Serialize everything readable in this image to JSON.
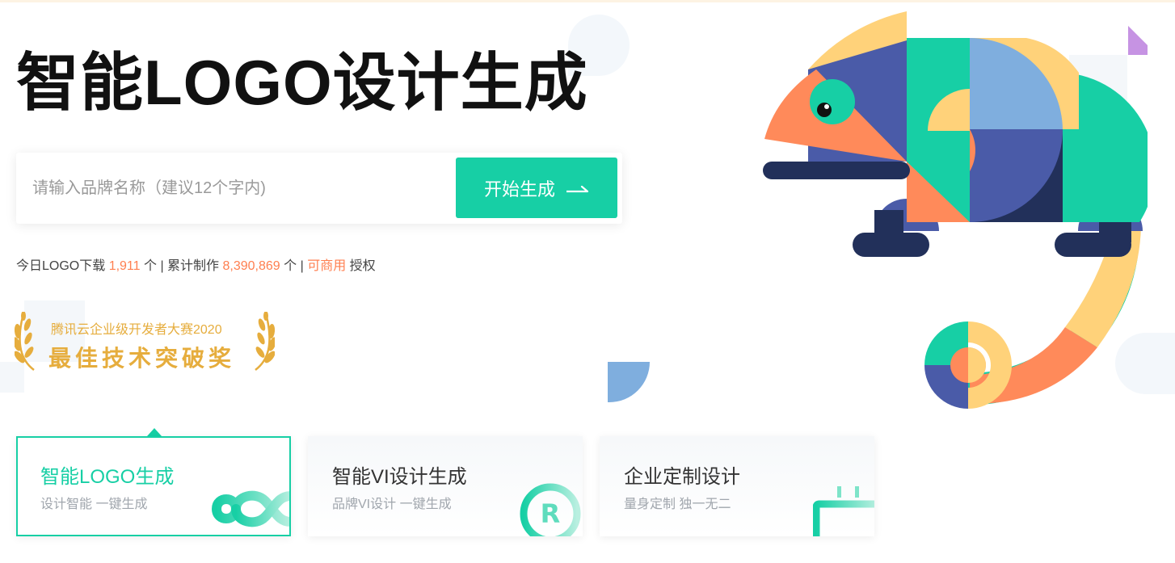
{
  "hero": {
    "title": "智能LOGO设计生成"
  },
  "search": {
    "placeholder": "请输入品牌名称（建议12个字内)",
    "button_label": "开始生成"
  },
  "stats": {
    "prefix": "今日LOGO下载 ",
    "downloads": "1,911",
    "mid1": " 个 | 累计制作 ",
    "total": "8,390,869",
    "mid2": " 个 | ",
    "commercial": "可商用",
    "suffix": " 授权"
  },
  "award": {
    "subtitle": "腾讯云企业级开发者大赛2020",
    "title": "最佳技术突破奖"
  },
  "cards": [
    {
      "title": "智能LOGO生成",
      "subtitle": "设计智能 一键生成",
      "icon": "infinity-icon",
      "active": true
    },
    {
      "title": "智能VI设计生成",
      "subtitle": "品牌VI设计 一键生成",
      "icon": "registered-icon",
      "active": false
    },
    {
      "title": "企业定制设计",
      "subtitle": "量身定制 独一无二",
      "icon": "plug-icon",
      "active": false
    }
  ],
  "colors": {
    "accent": "#17cfa5",
    "highlight": "#ff7f50",
    "award_gold": "#e6ad3d"
  }
}
